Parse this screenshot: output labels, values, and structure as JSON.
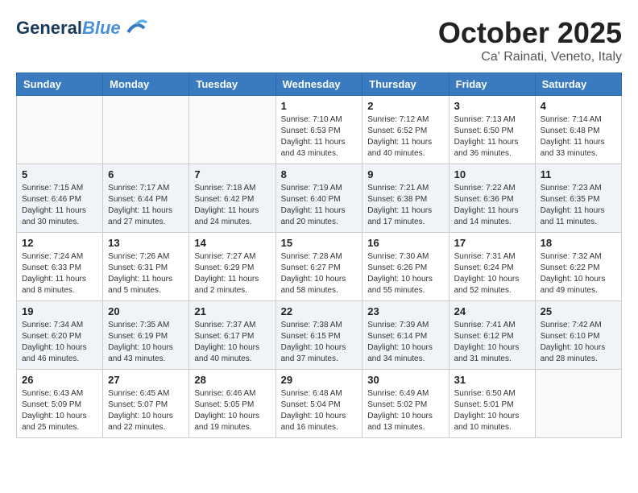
{
  "header": {
    "logo_line1": "General",
    "logo_line2": "Blue",
    "month": "October 2025",
    "location": "Ca' Rainati, Veneto, Italy"
  },
  "weekdays": [
    "Sunday",
    "Monday",
    "Tuesday",
    "Wednesday",
    "Thursday",
    "Friday",
    "Saturday"
  ],
  "weeks": [
    [
      {
        "day": "",
        "info": ""
      },
      {
        "day": "",
        "info": ""
      },
      {
        "day": "",
        "info": ""
      },
      {
        "day": "1",
        "info": "Sunrise: 7:10 AM\nSunset: 6:53 PM\nDaylight: 11 hours\nand 43 minutes."
      },
      {
        "day": "2",
        "info": "Sunrise: 7:12 AM\nSunset: 6:52 PM\nDaylight: 11 hours\nand 40 minutes."
      },
      {
        "day": "3",
        "info": "Sunrise: 7:13 AM\nSunset: 6:50 PM\nDaylight: 11 hours\nand 36 minutes."
      },
      {
        "day": "4",
        "info": "Sunrise: 7:14 AM\nSunset: 6:48 PM\nDaylight: 11 hours\nand 33 minutes."
      }
    ],
    [
      {
        "day": "5",
        "info": "Sunrise: 7:15 AM\nSunset: 6:46 PM\nDaylight: 11 hours\nand 30 minutes."
      },
      {
        "day": "6",
        "info": "Sunrise: 7:17 AM\nSunset: 6:44 PM\nDaylight: 11 hours\nand 27 minutes."
      },
      {
        "day": "7",
        "info": "Sunrise: 7:18 AM\nSunset: 6:42 PM\nDaylight: 11 hours\nand 24 minutes."
      },
      {
        "day": "8",
        "info": "Sunrise: 7:19 AM\nSunset: 6:40 PM\nDaylight: 11 hours\nand 20 minutes."
      },
      {
        "day": "9",
        "info": "Sunrise: 7:21 AM\nSunset: 6:38 PM\nDaylight: 11 hours\nand 17 minutes."
      },
      {
        "day": "10",
        "info": "Sunrise: 7:22 AM\nSunset: 6:36 PM\nDaylight: 11 hours\nand 14 minutes."
      },
      {
        "day": "11",
        "info": "Sunrise: 7:23 AM\nSunset: 6:35 PM\nDaylight: 11 hours\nand 11 minutes."
      }
    ],
    [
      {
        "day": "12",
        "info": "Sunrise: 7:24 AM\nSunset: 6:33 PM\nDaylight: 11 hours\nand 8 minutes."
      },
      {
        "day": "13",
        "info": "Sunrise: 7:26 AM\nSunset: 6:31 PM\nDaylight: 11 hours\nand 5 minutes."
      },
      {
        "day": "14",
        "info": "Sunrise: 7:27 AM\nSunset: 6:29 PM\nDaylight: 11 hours\nand 2 minutes."
      },
      {
        "day": "15",
        "info": "Sunrise: 7:28 AM\nSunset: 6:27 PM\nDaylight: 10 hours\nand 58 minutes."
      },
      {
        "day": "16",
        "info": "Sunrise: 7:30 AM\nSunset: 6:26 PM\nDaylight: 10 hours\nand 55 minutes."
      },
      {
        "day": "17",
        "info": "Sunrise: 7:31 AM\nSunset: 6:24 PM\nDaylight: 10 hours\nand 52 minutes."
      },
      {
        "day": "18",
        "info": "Sunrise: 7:32 AM\nSunset: 6:22 PM\nDaylight: 10 hours\nand 49 minutes."
      }
    ],
    [
      {
        "day": "19",
        "info": "Sunrise: 7:34 AM\nSunset: 6:20 PM\nDaylight: 10 hours\nand 46 minutes."
      },
      {
        "day": "20",
        "info": "Sunrise: 7:35 AM\nSunset: 6:19 PM\nDaylight: 10 hours\nand 43 minutes."
      },
      {
        "day": "21",
        "info": "Sunrise: 7:37 AM\nSunset: 6:17 PM\nDaylight: 10 hours\nand 40 minutes."
      },
      {
        "day": "22",
        "info": "Sunrise: 7:38 AM\nSunset: 6:15 PM\nDaylight: 10 hours\nand 37 minutes."
      },
      {
        "day": "23",
        "info": "Sunrise: 7:39 AM\nSunset: 6:14 PM\nDaylight: 10 hours\nand 34 minutes."
      },
      {
        "day": "24",
        "info": "Sunrise: 7:41 AM\nSunset: 6:12 PM\nDaylight: 10 hours\nand 31 minutes."
      },
      {
        "day": "25",
        "info": "Sunrise: 7:42 AM\nSunset: 6:10 PM\nDaylight: 10 hours\nand 28 minutes."
      }
    ],
    [
      {
        "day": "26",
        "info": "Sunrise: 6:43 AM\nSunset: 5:09 PM\nDaylight: 10 hours\nand 25 minutes."
      },
      {
        "day": "27",
        "info": "Sunrise: 6:45 AM\nSunset: 5:07 PM\nDaylight: 10 hours\nand 22 minutes."
      },
      {
        "day": "28",
        "info": "Sunrise: 6:46 AM\nSunset: 5:05 PM\nDaylight: 10 hours\nand 19 minutes."
      },
      {
        "day": "29",
        "info": "Sunrise: 6:48 AM\nSunset: 5:04 PM\nDaylight: 10 hours\nand 16 minutes."
      },
      {
        "day": "30",
        "info": "Sunrise: 6:49 AM\nSunset: 5:02 PM\nDaylight: 10 hours\nand 13 minutes."
      },
      {
        "day": "31",
        "info": "Sunrise: 6:50 AM\nSunset: 5:01 PM\nDaylight: 10 hours\nand 10 minutes."
      },
      {
        "day": "",
        "info": ""
      }
    ]
  ]
}
